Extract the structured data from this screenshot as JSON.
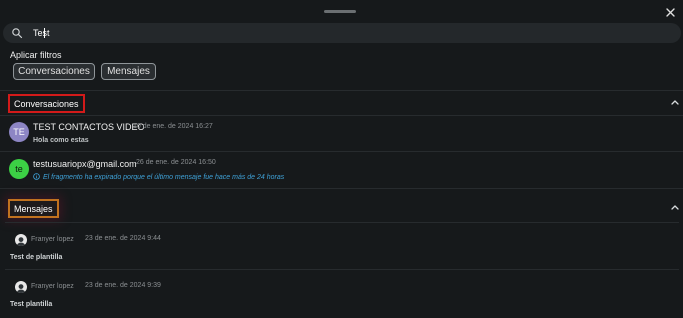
{
  "search": {
    "value": "Test"
  },
  "filters": {
    "title": "Aplicar filtros",
    "chips": [
      "Conversaciones",
      "Mensajes"
    ]
  },
  "sections": {
    "conversations": {
      "label": "Conversaciones",
      "items": [
        {
          "avatar_initials": "TE",
          "name": "TEST CONTACTOS VIDEO",
          "date": "10 de ene. de 2024 16:27",
          "preview": "Hola como estas"
        },
        {
          "avatar_initials": "te",
          "name": "testusuariopx@gmail.com",
          "date": "26 de ene. de 2024 16:50",
          "notice": "El fragmento ha expirado porque el último mensaje fue hace más de 24 horas"
        }
      ]
    },
    "messages": {
      "label": "Mensajes",
      "items": [
        {
          "user": "Franyer lopez",
          "date": "23 de ene. de 2024 9:44",
          "text": "Test de plantilla"
        },
        {
          "user": "Franyer lopez",
          "date": "23 de ene. de 2024 9:39",
          "text": "Test plantilla"
        }
      ]
    }
  },
  "colors": {
    "background": "#16191b",
    "highlight_red": "#d21a1a",
    "highlight_orange": "#c1721f",
    "notice_blue": "#3fa2d8",
    "avatar_purple": "#8d86c4",
    "avatar_green": "#3cd045"
  },
  "icons": [
    "search-icon",
    "close-icon",
    "chevron-up-icon",
    "info-icon",
    "user-avatar"
  ]
}
